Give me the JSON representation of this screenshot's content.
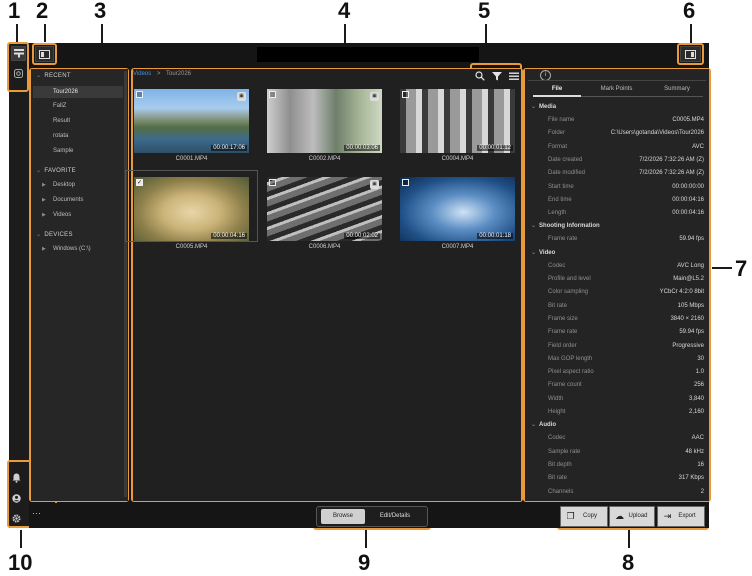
{
  "callouts": [
    "1",
    "2",
    "3",
    "4",
    "5",
    "6",
    "7",
    "8",
    "9",
    "10"
  ],
  "sidebar": {
    "sections": [
      {
        "title": "RECENT",
        "items": [
          "Tour2026",
          "FallZ",
          "Result",
          "rotata",
          "Sample"
        ]
      },
      {
        "title": "FAVORITE",
        "items": [
          "Desktop",
          "Documents",
          "Videos"
        ]
      },
      {
        "title": "DEVICES",
        "items": [
          "Windows (C:\\)"
        ]
      }
    ]
  },
  "breadcrumb": {
    "parent": "Videos",
    "sep": ">",
    "current": "Tour2026"
  },
  "thumbnails": [
    {
      "name": "C0001.MP4",
      "duration": "00:00:17:06",
      "checked": false
    },
    {
      "name": "C0002.MP4",
      "duration": "00:00:03:06",
      "checked": false
    },
    {
      "name": "C0004.MP4",
      "duration": "00:00:01:12",
      "checked": false
    },
    {
      "name": "C0005.MP4",
      "duration": "00:00:04:16",
      "checked": true
    },
    {
      "name": "C0006.MP4",
      "duration": "00:00:02:02",
      "checked": false
    },
    {
      "name": "C0007.MP4",
      "duration": "00:00:01:18",
      "checked": false
    }
  ],
  "info": {
    "icon_label": "i",
    "tabs": [
      "File",
      "Mark Points",
      "Summary"
    ],
    "sections": [
      {
        "title": "Media",
        "rows": [
          [
            "File name",
            "C0005.MP4"
          ],
          [
            "Folder",
            "C:\\Users\\gotanda\\Videos\\Tour2026"
          ],
          [
            "Format",
            "AVC"
          ],
          [
            "Date created",
            "7/2/2026 7:32:26 AM (Z)"
          ],
          [
            "Date modified",
            "7/2/2026 7:32:26 AM (Z)"
          ],
          [
            "Start time",
            "00:00:00:00"
          ],
          [
            "End time",
            "00:00:04:16"
          ],
          [
            "Length",
            "00:00:04:16"
          ]
        ]
      },
      {
        "title": "Shooting Information",
        "rows": [
          [
            "Frame rate",
            "59.94 fps"
          ]
        ]
      },
      {
        "title": "Video",
        "rows": [
          [
            "Codec",
            "AVC Long"
          ],
          [
            "Profile and level",
            "Main@L5.2"
          ],
          [
            "Color sampling",
            "YCbCr 4:2:0 8bit"
          ],
          [
            "Bit rate",
            "105 Mbps"
          ],
          [
            "Frame size",
            "3840 × 2160"
          ],
          [
            "Frame rate",
            "59.94 fps"
          ],
          [
            "Field order",
            "Progressive"
          ],
          [
            "Max GOP length",
            "30"
          ],
          [
            "Pixel aspect ratio",
            "1.0"
          ],
          [
            "Frame count",
            "256"
          ],
          [
            "Width",
            "3,840"
          ],
          [
            "Height",
            "2,160"
          ]
        ]
      },
      {
        "title": "Audio",
        "rows": [
          [
            "Codec",
            "AAC"
          ],
          [
            "Sample rate",
            "48 kHz"
          ],
          [
            "Bit depth",
            "16"
          ],
          [
            "Bit rate",
            "317 Kbps"
          ],
          [
            "Channels",
            "2"
          ]
        ]
      }
    ]
  },
  "mode_switch": {
    "browse": "Browse",
    "edit": "Edit/Details"
  },
  "actions": {
    "copy": "Copy",
    "upload": "Upload",
    "export": "Export"
  },
  "more_label": "···"
}
